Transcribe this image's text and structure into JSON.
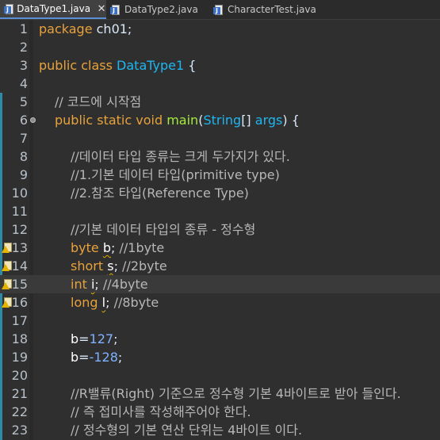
{
  "tabs": [
    {
      "label": "DataType1.java",
      "active": true,
      "close": "✕"
    },
    {
      "label": "DataType2.java",
      "active": false
    },
    {
      "label": "CharacterTest.java",
      "active": false
    }
  ],
  "editor": {
    "lines": [
      {
        "n": "1"
      },
      {
        "n": "2"
      },
      {
        "n": "3"
      },
      {
        "n": "4"
      },
      {
        "n": "5"
      },
      {
        "n": "6"
      },
      {
        "n": "7"
      },
      {
        "n": "8"
      },
      {
        "n": "9"
      },
      {
        "n": "10"
      },
      {
        "n": "11"
      },
      {
        "n": "12"
      },
      {
        "n": "13"
      },
      {
        "n": "14"
      },
      {
        "n": "15"
      },
      {
        "n": "16"
      },
      {
        "n": "17"
      },
      {
        "n": "18"
      },
      {
        "n": "19"
      },
      {
        "n": "20"
      },
      {
        "n": "21"
      },
      {
        "n": "22"
      },
      {
        "n": "23"
      }
    ],
    "code": {
      "l1_kw": "package",
      "l1_rest": " ch01;",
      "l3_kw": "public class",
      "l3_cls": "DataType1",
      "l3_rest": " {",
      "l5_cm": "// 코드에 시작점",
      "l6_kw": "public static void",
      "l6_m": "main",
      "l6_p1": "(",
      "l6_cls": "String",
      "l6_p2": "[] ",
      "l6_arg": "args",
      "l6_p3": ") {",
      "l8_cm": "//데이터 타입 종류는 크게 두가지가 있다.",
      "l9_cm": "//1.기본 데이터 타입(primitive type)",
      "l10_cm": "//2.참조 타입(Reference Type)",
      "l12_cm": "//기본 데이터 타입의 종류 - 정수형",
      "l13_kw": "byte",
      "l13_v": "b",
      "l13_rest": "; ",
      "l13_cm": "//1byte",
      "l14_kw": "short",
      "l14_v": "s",
      "l14_rest": "; ",
      "l14_cm": "//2byte",
      "l15_kw": "int",
      "l15_v": "i",
      "l15_rest": "; ",
      "l15_cm": "//4byte",
      "l16_kw": "long",
      "l16_v": "l",
      "l16_rest": "; ",
      "l16_cm": "//8byte",
      "l18_v": "b",
      "l18_eq": "=",
      "l18_num": "127",
      "l18_end": ";",
      "l19_v": "b",
      "l19_eq": "=",
      "l19_num": "-128",
      "l19_end": ";",
      "l21_cm": "//R밸류(Right) 기준으로 정수형 기본 4바이트로 받아 들인다.",
      "l22_cm": "// 즉 접미사를 작성해주어야 한다.",
      "l23_cm": "// 정수형의 기본 연산 단위는 4바이트 이다."
    }
  }
}
